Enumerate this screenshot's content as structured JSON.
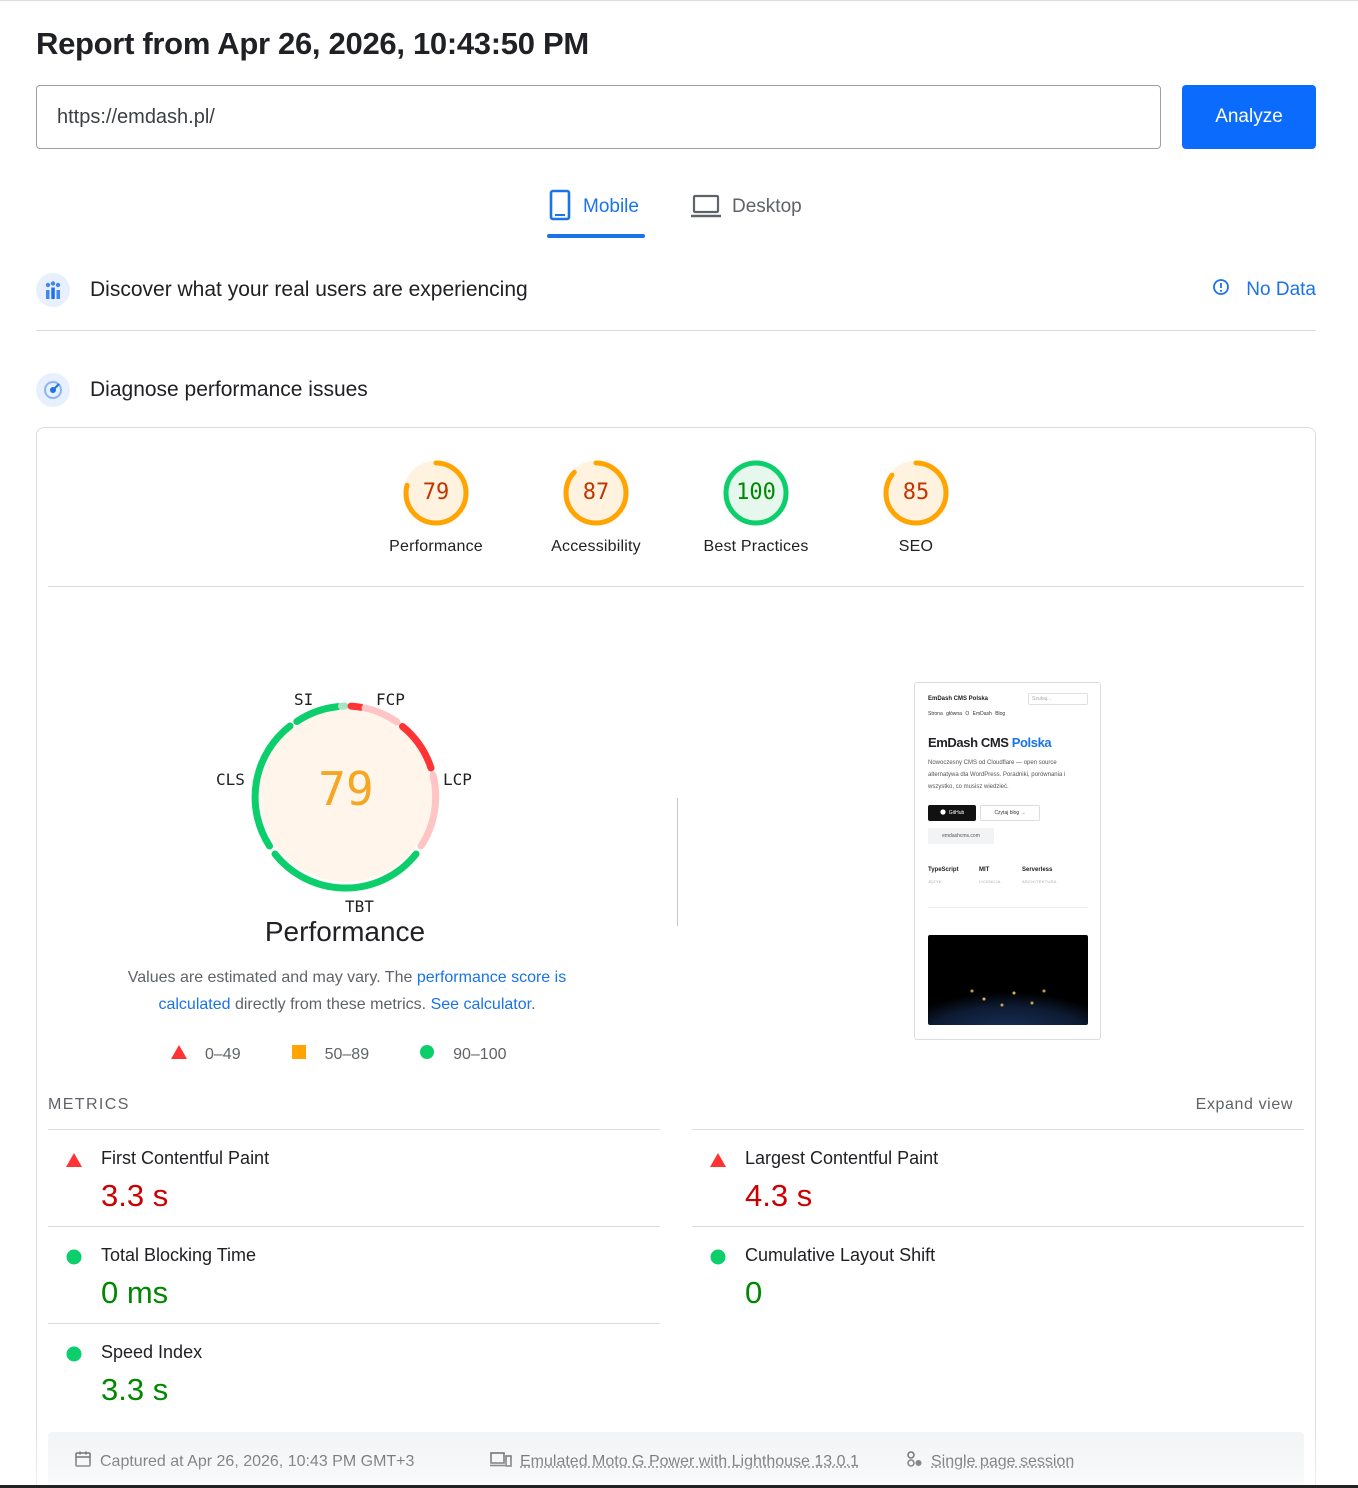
{
  "report": {
    "title": "Report from Apr 26, 2026, 10:43:50 PM",
    "url_value": "https://emdash.pl/",
    "analyze_label": "Analyze"
  },
  "tabs": {
    "mobile": "Mobile",
    "desktop": "Desktop",
    "active": "Mobile"
  },
  "field_data": {
    "title": "Discover what your real users are experiencing",
    "status": "No Data"
  },
  "lab_data": {
    "title": "Diagnose performance issues"
  },
  "categories": [
    {
      "label": "Performance",
      "score": "79",
      "value": 79,
      "rating": "average"
    },
    {
      "label": "Accessibility",
      "score": "87",
      "value": 87,
      "rating": "average"
    },
    {
      "label": "Best Practices",
      "score": "100",
      "value": 100,
      "rating": "pass"
    },
    {
      "label": "SEO",
      "score": "85",
      "value": 85,
      "rating": "average"
    }
  ],
  "performance_gauge": {
    "score": "79",
    "title": "Performance",
    "tags": {
      "si": "SI",
      "fcp": "FCP",
      "lcp": "LCP",
      "tbt": "TBT",
      "cls": "CLS"
    },
    "note_pre": "Values are estimated and may vary. The ",
    "note_link1": "performance score is calculated",
    "note_mid": " directly from these metrics. ",
    "note_link2": "See calculator",
    "note_post": "."
  },
  "legend": {
    "fail": "0–49",
    "average": "50–89",
    "pass": "90–100"
  },
  "screenshot": {
    "brand": "EmDash CMS Polska",
    "search_placeholder": "Szukaj...",
    "nav": "Strona główna  O EmDash  Blog",
    "heading_a": "EmDash CMS ",
    "heading_b": "Polska",
    "description": "Nowoczesny CMS od Cloudflare — open source alternatywa dla WordPress. Poradniki, porównania i wszystko, co musisz wiedzieć.",
    "btn_github": "GitHub",
    "btn_blog": "Czytaj blog →",
    "domain_pill": "emdashcms.com",
    "stats": [
      {
        "value": "TypeScript",
        "label": "JĘZYK"
      },
      {
        "value": "MIT",
        "label": "LICENCJA"
      },
      {
        "value": "Serverless",
        "label": "ARCHITEKTURA"
      }
    ]
  },
  "metrics": {
    "heading": "METRICS",
    "expand_label": "Expand view",
    "items": [
      {
        "name": "First Contentful Paint",
        "value": "3.3 s",
        "rating": "fail"
      },
      {
        "name": "Largest Contentful Paint",
        "value": "4.3 s",
        "rating": "fail"
      },
      {
        "name": "Total Blocking Time",
        "value": "0 ms",
        "rating": "pass"
      },
      {
        "name": "Cumulative Layout Shift",
        "value": "0",
        "rating": "pass"
      },
      {
        "name": "Speed Index",
        "value": "3.3 s",
        "rating": "pass"
      }
    ]
  },
  "footer": {
    "captured": "Captured at Apr 26, 2026, 10:43 PM GMT+3",
    "device": "Emulated Moto G Power with Lighthouse 13.0.1",
    "session": "Single page session"
  },
  "colors": {
    "accent": "#1a73e8",
    "button": "#0b6bfd",
    "fail": "#ff3333",
    "average": "#ffa400",
    "pass": "#0cce6b",
    "fail_text": "#cc0000",
    "average_text": "#c33300",
    "pass_text": "#008800"
  }
}
